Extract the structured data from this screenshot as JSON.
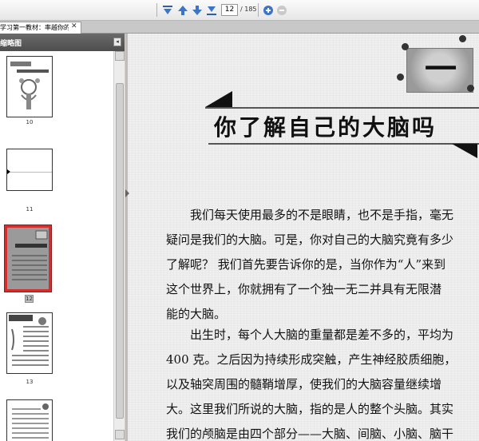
{
  "toolbar": {
    "page_current": "12",
    "page_total": "/ 185"
  },
  "tab": {
    "label": "学习第一教材：率越你的...",
    "close": "✕"
  },
  "panel": {
    "title": "缩略图",
    "collapse": "◂",
    "thumbnails": [
      {
        "label": "10"
      },
      {
        "label": "11"
      },
      {
        "label": "12",
        "selected": true
      },
      {
        "label": "13"
      }
    ]
  },
  "page": {
    "chapter": "一",
    "title": "你了解自己的大脑吗",
    "paragraph1": [
      "我们每天使用最多的不是眼睛，也不是手指，毫无",
      "疑问是我们的大脑。可是，你对自己的大脑究竟有多少",
      "了解呢？ 我们首先要告诉你的是，当你作为“人”来到",
      "这个世界上，你就拥有了一个独一无二并具有无限潜",
      "能的大脑。"
    ],
    "paragraph2": [
      "出生时，每个人大脑的重量都是差不多的，平均为",
      "400 克。之后因为持续形成突触，产生神经胶质细胞，",
      "以及轴突周围的髓鞘增厚，使我们的大脑容量继续增",
      "大。这里我们所说的大脑，指的是人的整个头脑。其实",
      "我们的颅脑是由四个部分——大脑、间脑、小脑、脑干"
    ]
  },
  "colors": {
    "panel_header": "#555555",
    "selected_thumb_border": "#d03030",
    "doc_background": "#efefef"
  }
}
